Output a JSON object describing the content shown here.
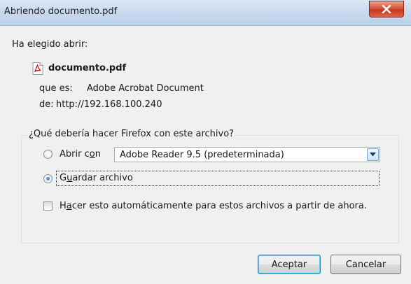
{
  "window": {
    "title": "Abriendo documento.pdf"
  },
  "dialog": {
    "intro": "Ha elegido abrir:",
    "file_name": "documento.pdf",
    "type_label": "que es:",
    "type_value": "Adobe Acrobat Document",
    "from_label": "de:",
    "from_value": "http://192.168.100.240"
  },
  "group": {
    "legend": "¿Qué debería hacer Firefox con este archivo?",
    "open_with": {
      "label_pre": "Abrir c",
      "label_key": "o",
      "label_post": "n",
      "selected": false
    },
    "app_select": {
      "value": "Adobe Reader 9.5 (predeterminada)"
    },
    "save_file": {
      "label_pre": "G",
      "label_key": "u",
      "label_post": "ardar archivo",
      "selected": true
    },
    "auto": {
      "label_pre": "H",
      "label_key": "a",
      "label_post": "cer esto automáticamente para estos archivos a partir de ahora.",
      "checked": false
    }
  },
  "buttons": {
    "ok": "Aceptar",
    "cancel": "Cancelar"
  },
  "icons": {
    "file": "pdf-icon",
    "close": "close-icon",
    "dropdown": "chevron-down-icon"
  },
  "colors": {
    "close_button": "#d9533a",
    "titlebar": "#c9d9ee",
    "radio_dot": "#1c5fb0"
  }
}
